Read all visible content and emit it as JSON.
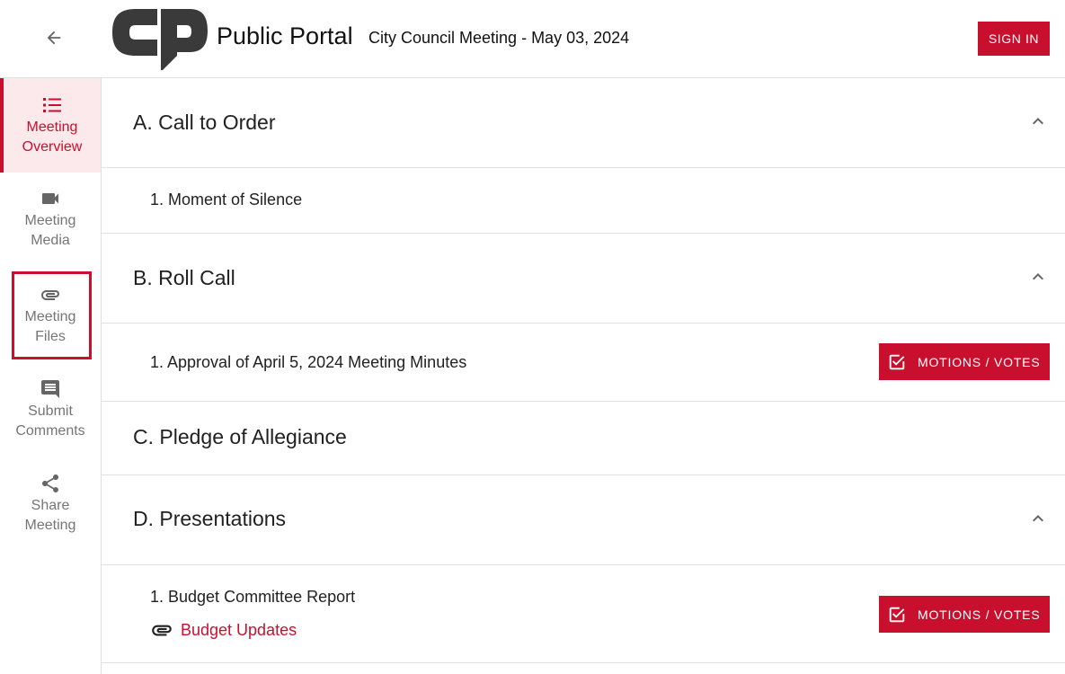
{
  "header": {
    "portal_title": "Public Portal",
    "meeting_title": "City Council Meeting - May 03, 2024",
    "sign_in_label": "SIGN IN",
    "back_icon": "arrow-left-icon",
    "logo_icon": "cp-logo"
  },
  "sidebar": {
    "items": [
      {
        "line1": "Meeting",
        "line2": "Overview",
        "icon": "list-icon",
        "active": true
      },
      {
        "line1": "Meeting",
        "line2": "Media",
        "icon": "video-camera-icon",
        "active": false
      },
      {
        "line1": "Meeting",
        "line2": "Files",
        "icon": "paperclip-icon",
        "active": false,
        "highlighted": true
      },
      {
        "line1": "Submit",
        "line2": "Comments",
        "icon": "comment-icon",
        "active": false
      },
      {
        "line1": "Share",
        "line2": "Meeting",
        "icon": "share-icon",
        "active": false
      }
    ]
  },
  "agenda": {
    "sections": [
      {
        "title": "A. Call to Order",
        "expanded": true,
        "items": [
          {
            "title": "1. Moment of Silence"
          }
        ]
      },
      {
        "title": "B. Roll Call",
        "expanded": true,
        "items": [
          {
            "title": "1. Approval of April 5, 2024 Meeting Minutes",
            "button": "MOTIONS / VOTES"
          }
        ]
      },
      {
        "title": "C. Pledge of Allegiance",
        "expanded": false,
        "items": []
      },
      {
        "title": "D. Presentations",
        "expanded": true,
        "items": [
          {
            "title": "1. Budget Committee Report",
            "button": "MOTIONS / VOTES",
            "attachment": "Budget Updates"
          }
        ]
      }
    ]
  },
  "colors": {
    "accent": "#c8102e",
    "active_bg": "#fbe9ec",
    "muted_text": "#757575",
    "divider": "#e0e0e0"
  }
}
